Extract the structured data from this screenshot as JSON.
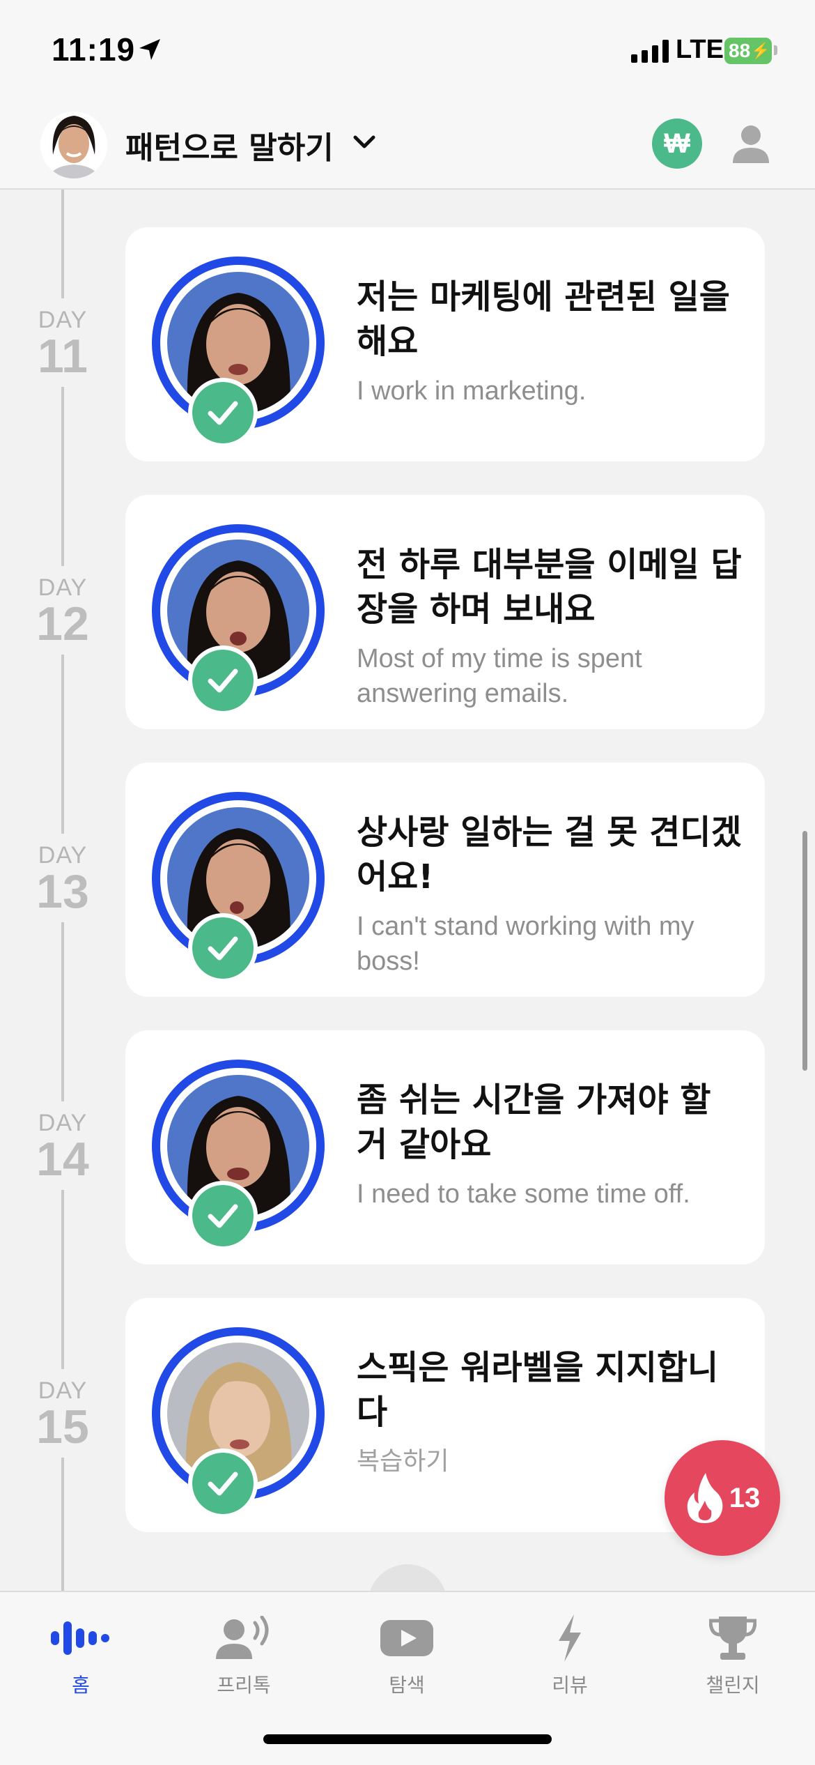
{
  "status_bar": {
    "time": "11:19",
    "network": "LTE",
    "battery": "88"
  },
  "header": {
    "title": "패턴으로 말하기",
    "coin_symbol": "₩"
  },
  "lessons": [
    {
      "day_word": "DAY",
      "day": "11",
      "korean": "저는 마케팅에 관련된 일을 해요",
      "english": "I work in marketing."
    },
    {
      "day_word": "DAY",
      "day": "12",
      "korean": "전 하루 대부분을 이메일 답장을 하며 보내요",
      "english": "Most of my time is spent answering emails."
    },
    {
      "day_word": "DAY",
      "day": "13",
      "korean": "상사랑 일하는 걸 못 견디겠어요!",
      "english": "I can't stand working with my boss!"
    },
    {
      "day_word": "DAY",
      "day": "14",
      "korean": "좀 쉬는 시간을 가져야 할 거 같아요",
      "english": "I need to take some time off."
    },
    {
      "day_word": "DAY",
      "day": "15",
      "korean": "스픽은 워라벨을 지지합니다",
      "english": "복습하기"
    }
  ],
  "streak": {
    "count": "13"
  },
  "tabs": [
    {
      "label": "홈",
      "icon": "waveform-icon",
      "active": true
    },
    {
      "label": "프리톡",
      "icon": "speaking-person-icon",
      "active": false
    },
    {
      "label": "탐색",
      "icon": "play-video-icon",
      "active": false
    },
    {
      "label": "리뷰",
      "icon": "lightning-icon",
      "active": false
    },
    {
      "label": "챌린지",
      "icon": "trophy-icon",
      "active": false
    }
  ],
  "colors": {
    "accent_blue": "#2149e6",
    "check_green": "#4cb98a",
    "streak_red": "#e5475e"
  }
}
